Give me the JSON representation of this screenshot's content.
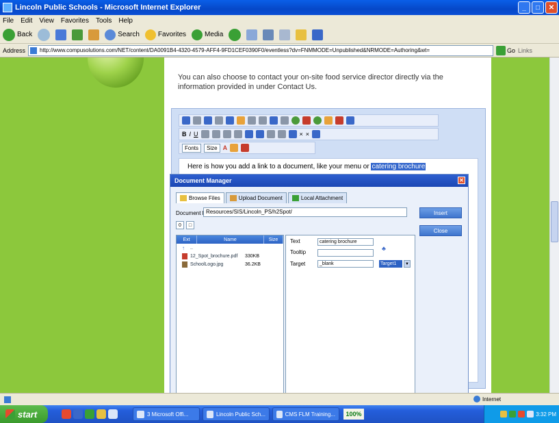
{
  "window": {
    "title": "Lincoln Public Schools - Microsoft Internet Explorer"
  },
  "menu": [
    "File",
    "Edit",
    "View",
    "Favorites",
    "Tools",
    "Help"
  ],
  "toolbar": {
    "back": "Back",
    "search": "Search",
    "favorites": "Favorites",
    "media": "Media"
  },
  "address": {
    "label": "Address",
    "url": "http://www.compusolutions.com/NET/content/DA0091B4-4320-4579-AFF4-9FD1CEF0390F0/eventless?dv=FNMMODE=Unpublished&NRMODE=Authoring&wt=",
    "go": "Go",
    "links": "Links"
  },
  "page": {
    "intro": "You can also choose to contact your on-site food service director directly via the information provided in under Contact Us."
  },
  "editor": {
    "font_select": "Fonts",
    "size_select": "Size",
    "text_before": "Here is how you add a link to a document, like your menu or ",
    "text_selected": "catering brochure"
  },
  "dialog": {
    "title": "Document Manager",
    "tabs": [
      "Browse Files",
      "Upload Document",
      "Local Attachment"
    ],
    "document_file_label": "Document File",
    "document_file_value": "Resources/SIS/Lincoln_PS/h2Spot/",
    "insert": "Insert",
    "close": "Close",
    "columns": [
      "Ext",
      "Name",
      "Size"
    ],
    "files": [
      {
        "name": "..",
        "size": ""
      },
      {
        "name": "12_Spot_brochure.pdf",
        "size": "330KB"
      },
      {
        "name": "SchoolLogo.jpg",
        "size": "36.2KB"
      }
    ],
    "props": {
      "text_label": "Text",
      "text_value": "catering brochure",
      "tooltip_label": "Tooltip",
      "tooltip_value": "",
      "target_label": "Target",
      "target_value": "_blank",
      "target_select": "Target1"
    }
  },
  "status": {
    "zone": "Internet"
  },
  "taskbar": {
    "start": "start",
    "tasks": [
      "3 Microsoft Offi...",
      "Lincoln Public Sch...",
      "CMS FLM Training..."
    ],
    "zoom": "100%",
    "clock": "3:32 PM"
  }
}
